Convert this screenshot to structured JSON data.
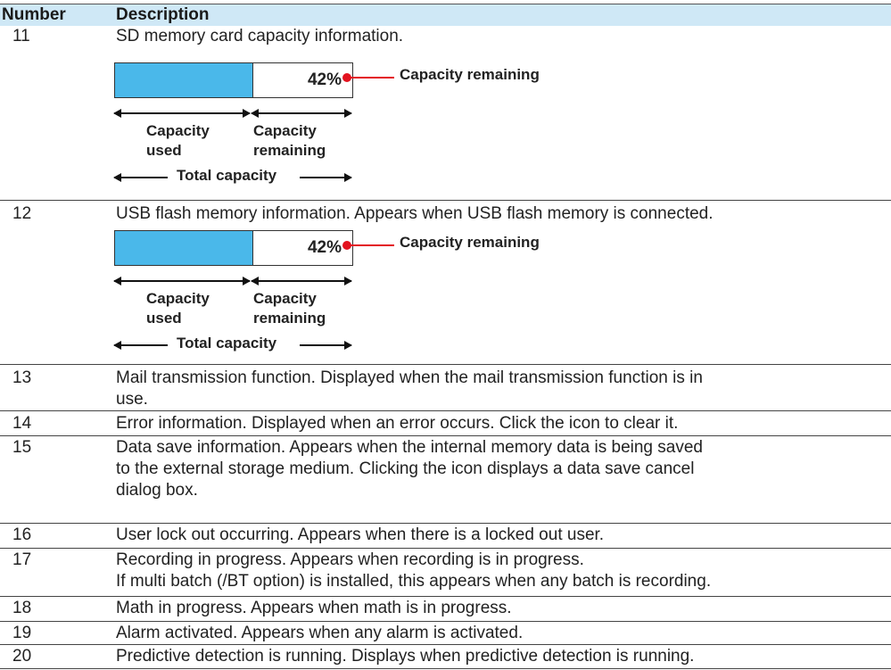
{
  "header": {
    "number": "Number",
    "description": "Description"
  },
  "rows": [
    {
      "number": "11",
      "lines": [
        "SD memory card capacity information."
      ]
    },
    {
      "number": "12",
      "lines": [
        "USB flash memory information. Appears when USB flash memory is connected."
      ]
    },
    {
      "number": "13",
      "lines": [
        "Mail transmission function. Displayed when the mail transmission function is in",
        "use."
      ]
    },
    {
      "number": "14",
      "lines": [
        "Error information. Displayed when an error occurs. Click the icon to clear it."
      ]
    },
    {
      "number": "15",
      "lines": [
        "Data save information. Appears when the internal memory data is being saved",
        "to the external storage medium. Clicking the icon displays a data save cancel",
        "dialog box."
      ]
    },
    {
      "number": "16",
      "lines": [
        "User lock out occurring. Appears when there is a locked out user."
      ]
    },
    {
      "number": "17",
      "lines": [
        "Recording in progress. Appears when recording is in progress.",
        "If multi batch (/BT option) is installed, this appears when any batch is recording."
      ]
    },
    {
      "number": "18",
      "lines": [
        "Math in progress. Appears when math is in progress."
      ]
    },
    {
      "number": "19",
      "lines": [
        "Alarm activated. Appears when any alarm is activated."
      ]
    },
    {
      "number": "20",
      "lines": [
        "Predictive detection is running. Displays when predictive detection is running."
      ]
    }
  ],
  "diagrams": [
    {
      "percent": "42%",
      "used_fraction": 0.58,
      "callout": "Capacity remaining",
      "label_used_1": "Capacity",
      "label_used_2": "used",
      "label_rem_1": "Capacity",
      "label_rem_2": "remaining",
      "label_total": "Total capacity",
      "fill_color": "#4ab8ea"
    },
    {
      "percent": "42%",
      "used_fraction": 0.58,
      "callout": "Capacity remaining",
      "label_used_1": "Capacity",
      "label_used_2": "used",
      "label_rem_1": "Capacity",
      "label_rem_2": "remaining",
      "label_total": "Total capacity",
      "fill_color": "#4ab8ea"
    }
  ]
}
